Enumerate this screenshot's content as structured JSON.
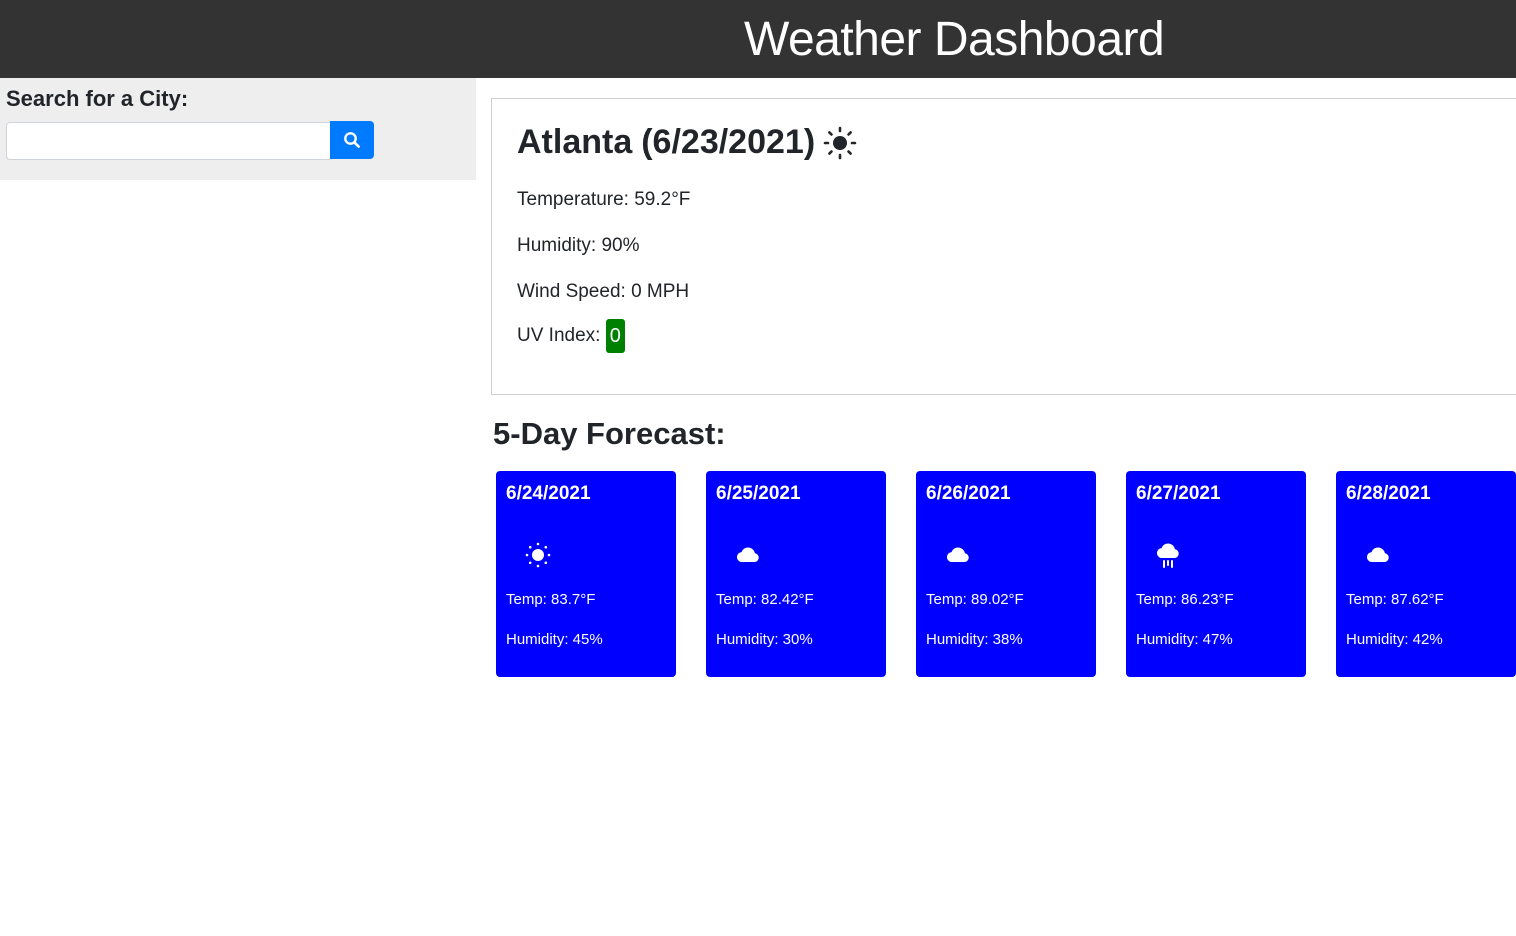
{
  "header": {
    "title": "Weather Dashboard"
  },
  "search": {
    "label": "Search for a City:",
    "placeholder": "",
    "value": ""
  },
  "current": {
    "city": "Atlanta",
    "date": "(6/23/2021)",
    "icon": "sun-icon",
    "temperature": "Temperature: 59.2°F",
    "humidity": "Humidity: 90%",
    "wind": "Wind Speed: 0 MPH",
    "uv_label": "UV Index:",
    "uv_value": "0",
    "uv_color": "#008000"
  },
  "forecast": {
    "heading": "5-Day Forecast:",
    "card_color": "#0000ff",
    "days": [
      {
        "date": "6/24/2021",
        "icon": "sun-icon",
        "temp": "Temp: 83.7°F",
        "humidity": "Humidity: 45%"
      },
      {
        "date": "6/25/2021",
        "icon": "cloud-icon",
        "temp": "Temp: 82.42°F",
        "humidity": "Humidity: 30%"
      },
      {
        "date": "6/26/2021",
        "icon": "cloud-icon",
        "temp": "Temp: 89.02°F",
        "humidity": "Humidity: 38%"
      },
      {
        "date": "6/27/2021",
        "icon": "rain-cloud-icon",
        "temp": "Temp: 86.23°F",
        "humidity": "Humidity: 47%"
      },
      {
        "date": "6/28/2021",
        "icon": "cloud-icon",
        "temp": "Temp: 87.62°F",
        "humidity": "Humidity: 42%"
      }
    ]
  }
}
